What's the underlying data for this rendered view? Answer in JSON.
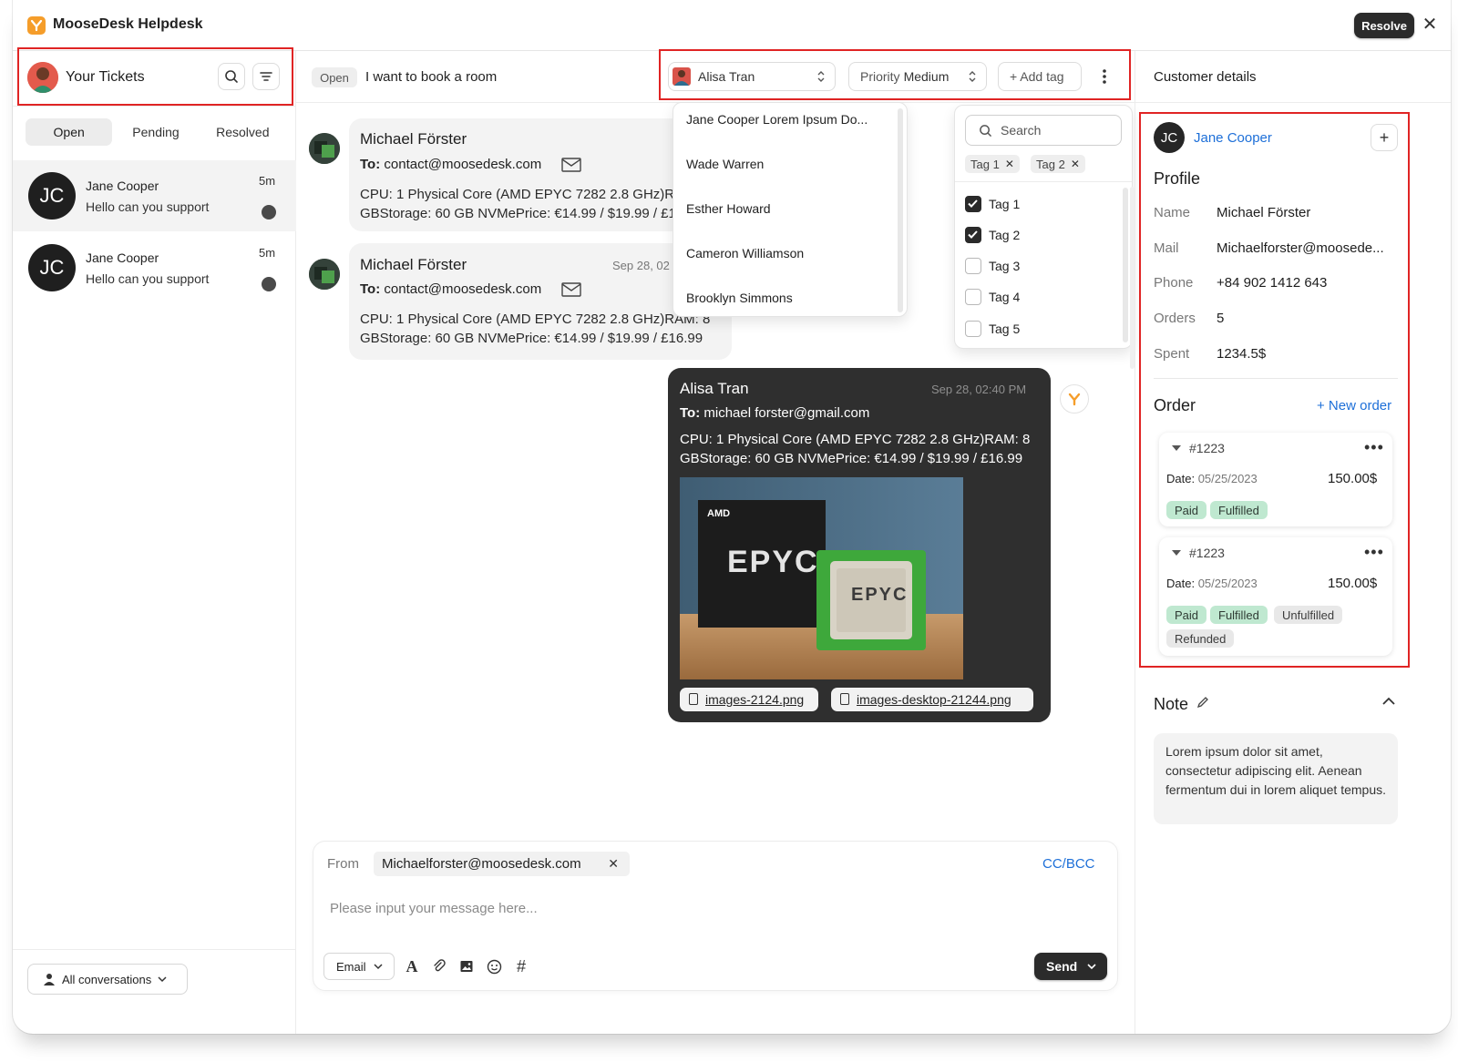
{
  "app": {
    "title": "MooseDesk Helpdesk",
    "resolve_label": "Resolve",
    "close_glyph": "✕"
  },
  "sidebar": {
    "title": "Your Tickets",
    "tabs": [
      {
        "label": "Open",
        "active": true
      },
      {
        "label": "Pending",
        "active": false
      },
      {
        "label": "Resolved",
        "active": false
      }
    ],
    "tickets": [
      {
        "initials": "JC",
        "name": "Jane Cooper",
        "message": "Hello can you support",
        "time": "5m"
      },
      {
        "initials": "JC",
        "name": "Jane Cooper",
        "message": "Hello can you support",
        "time": "5m"
      }
    ],
    "footer_filter": "All conversations"
  },
  "conversation": {
    "status": "Open",
    "subject": "I want to book a room",
    "assignee": "Alisa Tran",
    "priority_label": "Priority",
    "priority_value": "Medium",
    "add_tag_label": "+ Add tag",
    "messages": [
      {
        "from": "Michael Förster",
        "to_label": "To:",
        "to": "contact@moosedesk.com",
        "line1": "CPU: 1 Physical Core (AMD EPYC 7282 2.8 GHz)RAM: 8",
        "line2": "GBStorage: 60 GB NVMePrice: €14.99 / $19.99 / £16.99"
      },
      {
        "from": "Michael Förster",
        "date": "Sep 28, 02",
        "to_label": "To:",
        "to": "contact@moosedesk.com",
        "line1": "CPU: 1 Physical Core (AMD EPYC 7282 2.8 GHz)RAM: 8",
        "line2": "GBStorage: 60 GB NVMePrice: €14.99 / $19.99 / £16.99"
      },
      {
        "from": "Alisa Tran",
        "date": "Sep 28, 02:40 PM",
        "to_label": "To:",
        "to": "michael forster@gmail.com",
        "line1": "CPU: 1 Physical Core (AMD EPYC 7282 2.8 GHz)RAM: 8",
        "line2": "GBStorage: 60 GB NVMePrice: €14.99 / $19.99 / £16.99",
        "image_box_text": "AMD",
        "image_chip_text": "EPYC",
        "image_box_brand": "EPYC",
        "attachments": [
          "images-2124.png",
          "images-desktop-21244.png"
        ]
      }
    ]
  },
  "assignee_dropdown": {
    "options": [
      "Jane Cooper Lorem Ipsum Do...",
      "Wade Warren",
      "Esther Howard",
      "Cameron Williamson",
      "Brooklyn Simmons"
    ]
  },
  "tag_dropdown": {
    "search_placeholder": "Search",
    "selected_chips": [
      "Tag 1",
      "Tag 2"
    ],
    "chip_remove_glyph": "✕",
    "options": [
      {
        "label": "Tag 1",
        "checked": true
      },
      {
        "label": "Tag 2",
        "checked": true
      },
      {
        "label": "Tag 3",
        "checked": false
      },
      {
        "label": "Tag 4",
        "checked": false
      },
      {
        "label": "Tag 5",
        "checked": false
      }
    ]
  },
  "composer": {
    "from_label": "From",
    "from_value": "Michaelforster@moosedesk.com",
    "cc_bcc": "CC/BCC",
    "placeholder": "Please input your message here...",
    "channel": "Email",
    "send_label": "Send",
    "toolbar_text_glyph": "A",
    "toolbar_hash_glyph": "#"
  },
  "customer": {
    "panel_title": "Customer details",
    "initials": "JC",
    "name": "Jane Cooper",
    "plus_glyph": "+",
    "profile_title": "Profile",
    "profile": [
      {
        "key": "Name",
        "value": "Michael Förster"
      },
      {
        "key": "Mail",
        "value": "Michaelforster@moosede..."
      },
      {
        "key": "Phone",
        "value": "+84 902 1412 643"
      },
      {
        "key": "Orders",
        "value": "5"
      },
      {
        "key": "Spent",
        "value": "1234.5$"
      }
    ],
    "order_title": "Order",
    "new_order": "+ New order",
    "orders": [
      {
        "id": "#1223",
        "date_label": "Date:",
        "date": "05/25/2023",
        "amount": "150.00$",
        "badges": [
          "Paid",
          "Fulfilled"
        ]
      },
      {
        "id": "#1223",
        "date_label": "Date:",
        "date": "05/25/2023",
        "amount": "150.00$",
        "badges": [
          "Paid",
          "Fulfilled",
          "Unfulfilled",
          "Refunded"
        ]
      }
    ],
    "more_glyph": "•••",
    "note_title": "Note",
    "note_text": "Lorem ipsum dolor sit amet, consectetur adipiscing elit. Aenean fermentum dui in lorem aliquet tempus."
  },
  "colors": {
    "accent_link": "#1d6fd8",
    "highlight_box": "#e02424",
    "badge_green": "#bfe8d0",
    "dark_button": "#2b2b2b",
    "brand_orange": "#f59d2a"
  }
}
